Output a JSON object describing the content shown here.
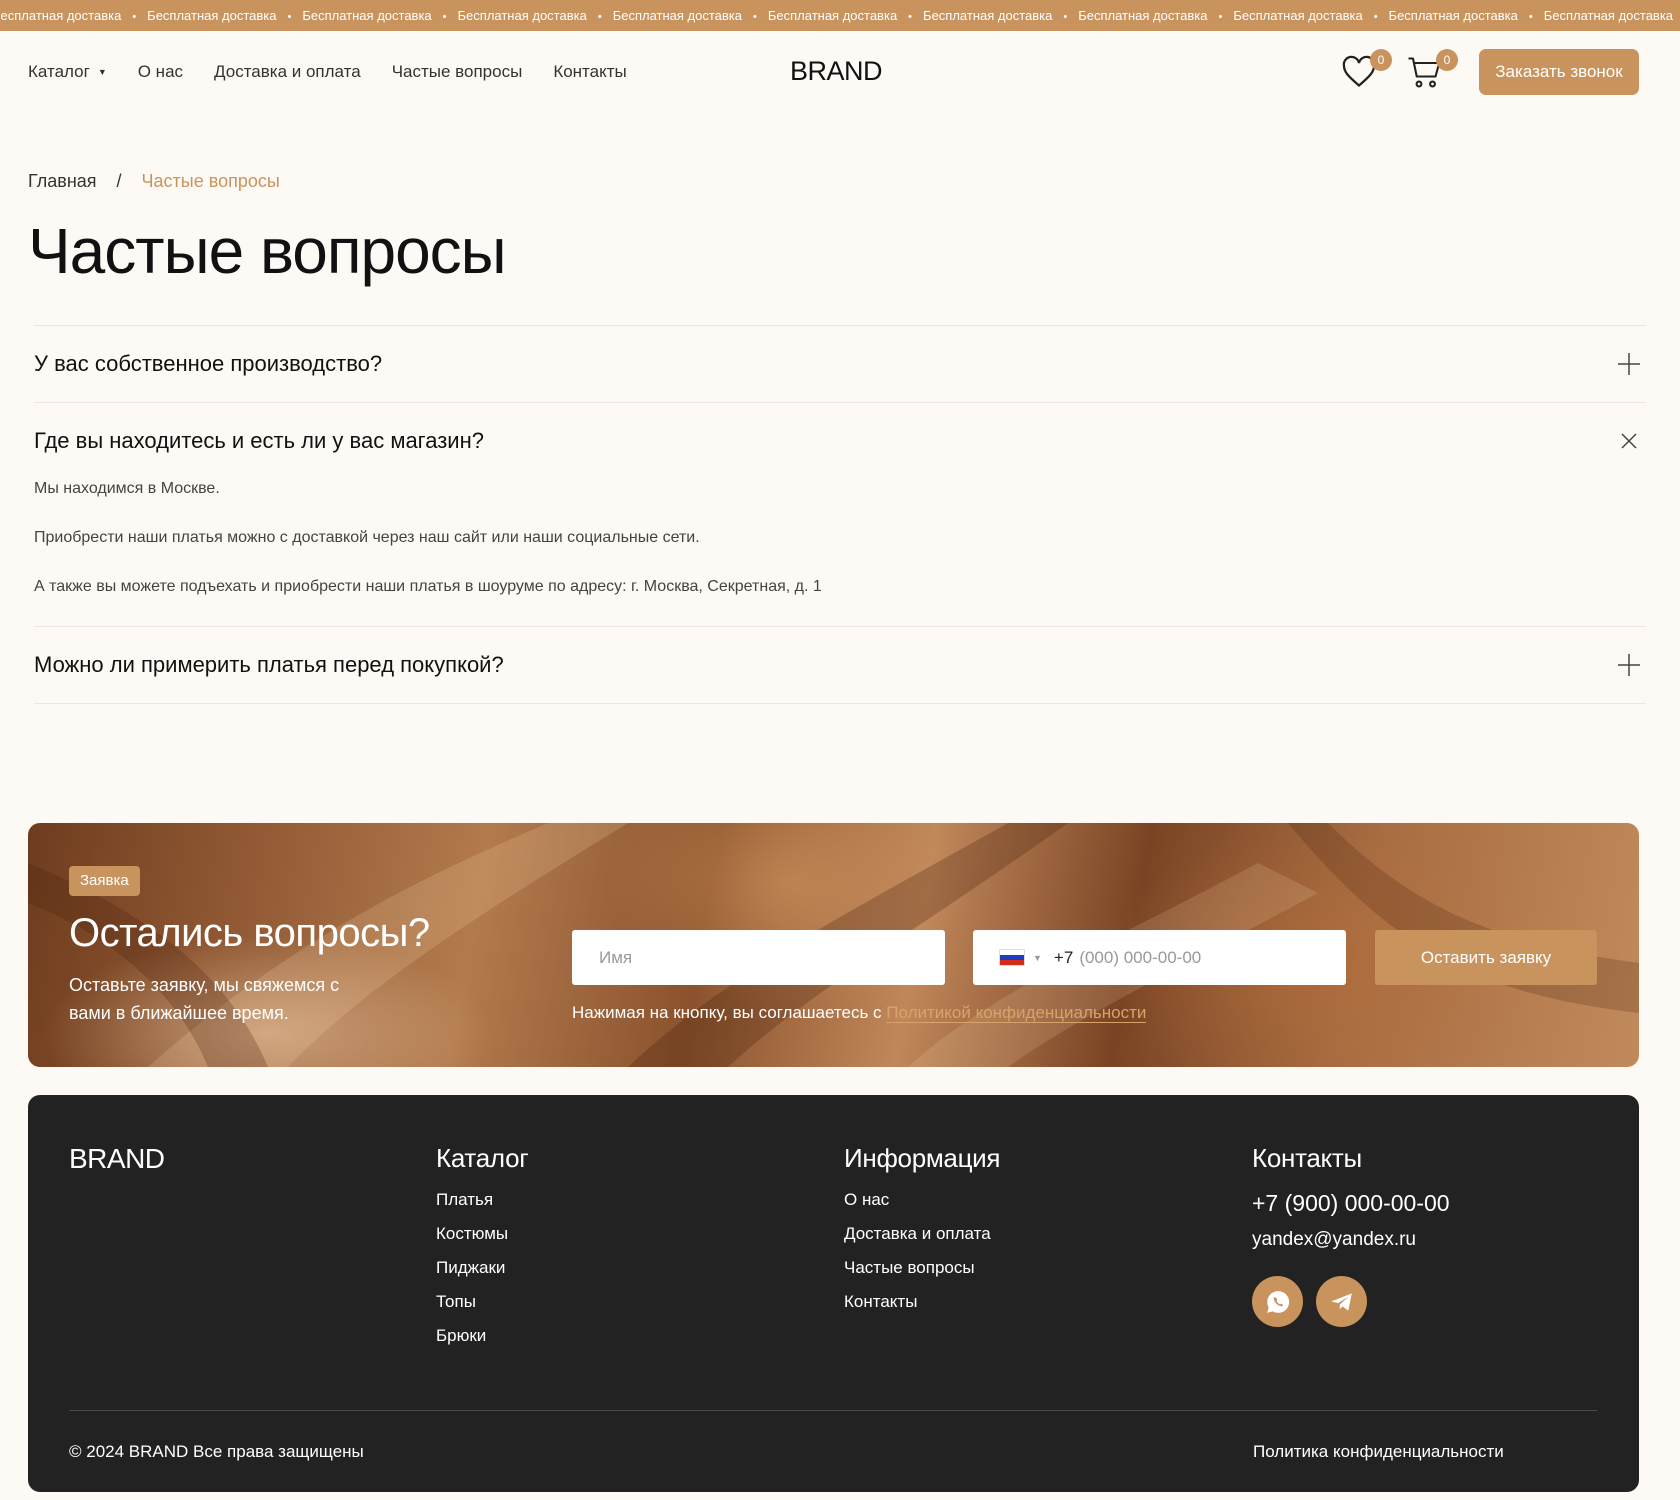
{
  "marquee": {
    "text": "Бесплатная доставка",
    "separator": "•",
    "repeat": 12
  },
  "header": {
    "nav": [
      {
        "label": "Каталог",
        "has_dropdown": true
      },
      {
        "label": "О нас"
      },
      {
        "label": "Доставка и оплата"
      },
      {
        "label": "Частые вопросы"
      },
      {
        "label": "Контакты"
      }
    ],
    "brand": "BRAND",
    "wishlist_count": "0",
    "cart_count": "0",
    "call_button": "Заказать звонок"
  },
  "breadcrumb": {
    "home": "Главная",
    "separator": "/",
    "current": "Частые вопросы"
  },
  "page_title": "Частые вопросы",
  "faq": [
    {
      "question": "У вас собственное производство?",
      "expanded": false,
      "answer": []
    },
    {
      "question": "Где вы находитесь и есть ли у вас магазин?",
      "expanded": true,
      "answer": [
        "Мы находимся в Москве.",
        "Приобрести наши платья можно с доставкой через наш сайт или наши социальные сети.",
        "А также вы можете подъехать и приобрести наши платья в шоуруме по адресу: г. Москва, Секретная, д. 1"
      ]
    },
    {
      "question": "Можно ли примерить платья перед покупкой?",
      "expanded": false,
      "answer": []
    }
  ],
  "cta": {
    "tag": "Заявка",
    "title": "Остались вопросы?",
    "subtitle": "Оставьте заявку, мы свяжемся с вами в ближайшее время.",
    "name_placeholder": "Имя",
    "phone_code": "+7",
    "phone_placeholder": "(000) 000-00-00",
    "submit": "Оставить заявку",
    "consent_text": "Нажимая на кнопку, вы соглашаетесь с",
    "consent_link": "Политикой конфиденциальности"
  },
  "footer": {
    "brand": "BRAND",
    "catalog": {
      "title": "Каталог",
      "items": [
        "Платья",
        "Костюмы",
        "Пиджаки",
        "Топы",
        "Брюки"
      ]
    },
    "info": {
      "title": "Информация",
      "items": [
        "О нас",
        "Доставка и оплата",
        "Частые вопросы",
        "Контакты"
      ]
    },
    "contacts": {
      "title": "Контакты",
      "phone": "+7 (900) 000-00-00",
      "email": "yandex@yandex.ru",
      "socials": [
        "whatsapp-icon",
        "telegram-icon"
      ]
    },
    "copyright": "© 2024 BRAND Все права защищены",
    "privacy": "Политика конфиденциальности"
  },
  "colors": {
    "accent": "#c9935e",
    "background": "#fdfaf5",
    "footer_bg": "#222222"
  }
}
